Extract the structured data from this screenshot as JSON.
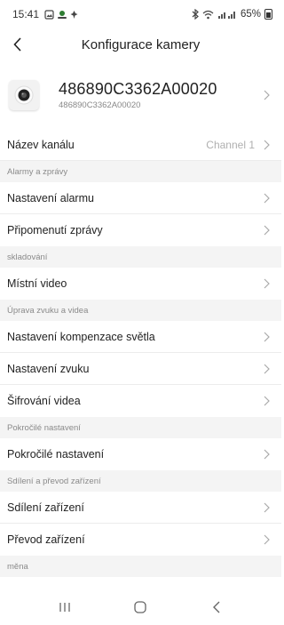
{
  "status": {
    "time": "15:41",
    "battery": "65%"
  },
  "header": {
    "title": "Konfigurace kamery"
  },
  "device": {
    "name": "486890C3362A00020",
    "id": "486890C3362A00020"
  },
  "channel": {
    "label": "Název kanálu",
    "value": "Channel 1"
  },
  "sections": {
    "alarms": "Alarmy a zprávy",
    "storage": "skladování",
    "av": "Úprava zvuku a videa",
    "advanced": "Pokročilé nastavení",
    "sharing": "Sdílení a převod zařízení",
    "currency": "měna"
  },
  "rows": {
    "alarm_settings": "Nastavení alarmu",
    "message_reminder": "Připomenutí zprávy",
    "local_video": "Místní video",
    "backlight": "Nastavení kompenzace světla",
    "sound": "Nastavení zvuku",
    "encryption": "Šifrování videa",
    "advanced": "Pokročilé nastavení",
    "share": "Sdílení zařízení",
    "transfer": "Převod zařízení"
  }
}
